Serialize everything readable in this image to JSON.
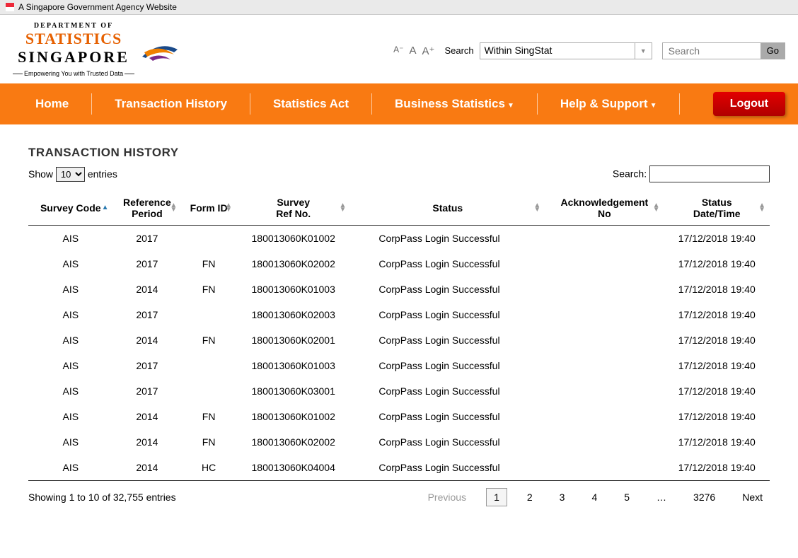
{
  "banner": "A Singapore Government Agency Website",
  "logo": {
    "dept": "DEPARTMENT OF",
    "stats": "STATISTICS",
    "sg": "SINGAPORE",
    "tag": "Empowering You with Trusted Data"
  },
  "fontsize": {
    "minus": "A⁻",
    "normal": "A",
    "plus": "A⁺"
  },
  "scope": {
    "label": "Search",
    "selected": "Within SingStat"
  },
  "search": {
    "placeholder": "Search",
    "go": "Go"
  },
  "nav": {
    "home": "Home",
    "history": "Transaction History",
    "act": "Statistics Act",
    "biz": "Business Statistics",
    "help": "Help & Support",
    "logout": "Logout"
  },
  "title": "TRANSACTION HISTORY",
  "entries": {
    "show": "Show",
    "entries_word": "entries",
    "selected": "10"
  },
  "table_search_label": "Search:",
  "columns": [
    "Survey Code",
    "Reference Period",
    "Form ID",
    "Survey Ref No.",
    "Status",
    "Acknowledgement No",
    "Status Date/Time"
  ],
  "rows": [
    {
      "code": "AIS",
      "period": "2017",
      "form": "",
      "ref": "180013060K01002",
      "status": "CorpPass Login Successful",
      "ack": "",
      "dt": "17/12/2018 19:40"
    },
    {
      "code": "AIS",
      "period": "2017",
      "form": "FN",
      "ref": "180013060K02002",
      "status": "CorpPass Login Successful",
      "ack": "",
      "dt": "17/12/2018 19:40"
    },
    {
      "code": "AIS",
      "period": "2014",
      "form": "FN",
      "ref": "180013060K01003",
      "status": "CorpPass Login Successful",
      "ack": "",
      "dt": "17/12/2018 19:40"
    },
    {
      "code": "AIS",
      "period": "2017",
      "form": "",
      "ref": "180013060K02003",
      "status": "CorpPass Login Successful",
      "ack": "",
      "dt": "17/12/2018 19:40"
    },
    {
      "code": "AIS",
      "period": "2014",
      "form": "FN",
      "ref": "180013060K02001",
      "status": "CorpPass Login Successful",
      "ack": "",
      "dt": "17/12/2018 19:40"
    },
    {
      "code": "AIS",
      "period": "2017",
      "form": "",
      "ref": "180013060K01003",
      "status": "CorpPass Login Successful",
      "ack": "",
      "dt": "17/12/2018 19:40"
    },
    {
      "code": "AIS",
      "period": "2017",
      "form": "",
      "ref": "180013060K03001",
      "status": "CorpPass Login Successful",
      "ack": "",
      "dt": "17/12/2018 19:40"
    },
    {
      "code": "AIS",
      "period": "2014",
      "form": "FN",
      "ref": "180013060K01002",
      "status": "CorpPass Login Successful",
      "ack": "",
      "dt": "17/12/2018 19:40"
    },
    {
      "code": "AIS",
      "period": "2014",
      "form": "FN",
      "ref": "180013060K02002",
      "status": "CorpPass Login Successful",
      "ack": "",
      "dt": "17/12/2018 19:40"
    },
    {
      "code": "AIS",
      "period": "2014",
      "form": "HC",
      "ref": "180013060K04004",
      "status": "CorpPass Login Successful",
      "ack": "",
      "dt": "17/12/2018 19:40"
    }
  ],
  "info": "Showing 1 to 10 of 32,755 entries",
  "pagination": {
    "prev": "Previous",
    "pages": [
      "1",
      "2",
      "3",
      "4",
      "5",
      "…",
      "3276"
    ],
    "next": "Next",
    "active": "1"
  }
}
